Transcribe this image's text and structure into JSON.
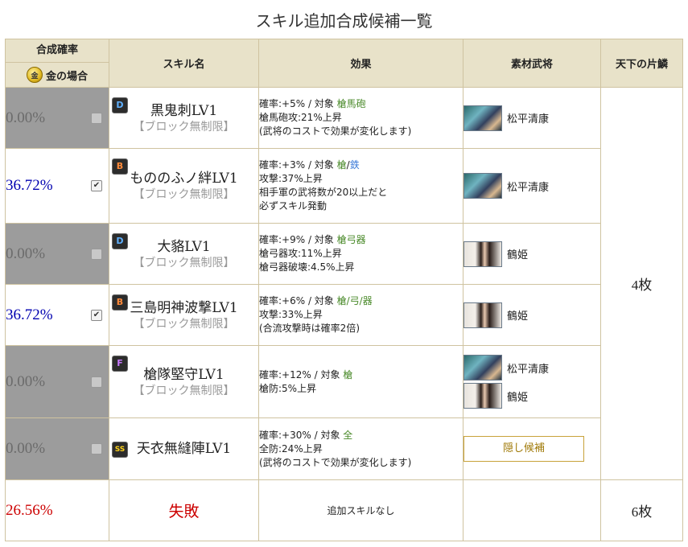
{
  "title": "スキル追加合成候補一覧",
  "headers": {
    "rate": "合成確率",
    "gold_case": "金の場合",
    "skill": "スキル名",
    "effect": "効果",
    "material": "素材武将",
    "scale": "天下の片鱗"
  },
  "rows": [
    {
      "rate": "0.00%",
      "checked": false,
      "rank": "D",
      "name": "黒鬼刺LV1",
      "sub": "【ブロック無制限】",
      "effect": {
        "l1a": "確率:+5% / 対象 ",
        "l1b": "槍馬砲",
        "l2": "槍馬砲攻:21%上昇",
        "l3": "(武将のコストで効果が変化します)"
      },
      "generals": [
        "松平清康"
      ]
    },
    {
      "rate": "36.72%",
      "checked": true,
      "rank": "B",
      "name": "もののふノ絆LV1",
      "sub": "【ブロック無制限】",
      "effect": {
        "l1a": "確率:+3% / 対象 ",
        "l1b": "槍",
        "l1c": "/",
        "l1d": "鉄",
        "l2": "攻撃:37%上昇",
        "l3": "相手軍の武将数が20以上だと",
        "l4": "必ずスキル発動"
      },
      "generals": [
        "松平清康"
      ]
    },
    {
      "rate": "0.00%",
      "checked": false,
      "rank": "D",
      "name": "大貉LV1",
      "sub": "【ブロック無制限】",
      "effect": {
        "l1a": "確率:+9% / 対象 ",
        "l1b": "槍弓器",
        "l2": "槍弓器攻:11%上昇",
        "l3": "槍弓器破壊:4.5%上昇"
      },
      "generals": [
        "鶴姫"
      ]
    },
    {
      "rate": "36.72%",
      "checked": true,
      "rank": "B",
      "name": "三島明神波撃LV1",
      "sub": "【ブロック無制限】",
      "effect": {
        "l1a": "確率:+6% / 対象 ",
        "l1b": "槍/弓/器",
        "l2": "攻撃:33%上昇",
        "l3": "(合流攻撃時は確率2倍)"
      },
      "generals": [
        "鶴姫"
      ]
    },
    {
      "rate": "0.00%",
      "checked": false,
      "rank": "F",
      "name": "槍隊堅守LV1",
      "sub": "【ブロック無制限】",
      "effect": {
        "l1a": "確率:+12% / 対象 ",
        "l1b": "槍",
        "l2": "槍防:5%上昇"
      },
      "generals": [
        "松平清康",
        "鶴姫"
      ]
    },
    {
      "rate": "0.00%",
      "checked": false,
      "rank": "SS",
      "name": "天衣無縫陣LV1",
      "effect": {
        "l1a": "確率:+30% / 対象 ",
        "l1b": "全",
        "l2": "全防:24%上昇",
        "l3": "(武将のコストで効果が変化します)"
      },
      "hidden_label": "隠し候補"
    }
  ],
  "scale_count": "4枚",
  "fail_row": {
    "rate": "26.56%",
    "result": "失敗",
    "effect": "追加スキルなし",
    "scale": "6枚"
  },
  "colors": {
    "header_bg": "#e8e2c9",
    "disabled_bg": "#9c9c9c",
    "rate_blue": "#0000b0",
    "fail_red": "#cc0000"
  }
}
